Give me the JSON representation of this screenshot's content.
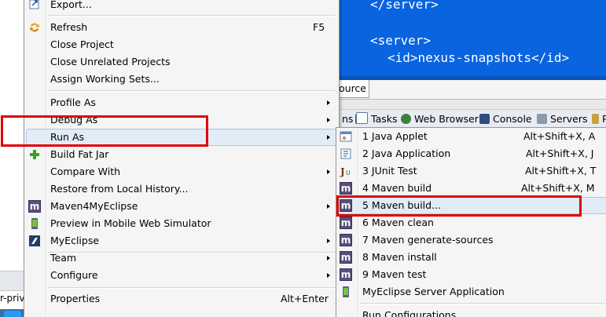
{
  "editor": {
    "lines": [
      "</server>",
      "<server>",
      "<id>nexus-snapshots</id>"
    ]
  },
  "source_tab": {
    "label": "ource"
  },
  "views_bar": {
    "tabs": [
      {
        "label": "ns",
        "icon": "console-icon"
      },
      {
        "label": "Tasks",
        "icon": "tasks-icon"
      },
      {
        "label": "Web Browser",
        "icon": "globe-icon"
      },
      {
        "label": "Console",
        "icon": "console-icon"
      },
      {
        "label": "Servers",
        "icon": "servers-icon"
      },
      {
        "label": "P",
        "icon": "generic-icon"
      }
    ]
  },
  "left_panel": {
    "snippet": "r-priv"
  },
  "context_menu": {
    "items": [
      {
        "label": "Export...",
        "icon": "export-icon"
      },
      {
        "label": "Refresh",
        "shortcut": "F5",
        "icon": "refresh-icon"
      },
      {
        "label": "Close Project"
      },
      {
        "label": "Close Unrelated Projects"
      },
      {
        "label": "Assign Working Sets..."
      },
      {
        "label": "Profile As",
        "submenu": true
      },
      {
        "label": "Debug As",
        "submenu": true
      },
      {
        "label": "Run As",
        "submenu": true,
        "highlighted": true
      },
      {
        "label": "Build Fat Jar",
        "icon": "plus-icon"
      },
      {
        "label": "Compare With",
        "submenu": true
      },
      {
        "label": "Restore from Local History..."
      },
      {
        "label": "Maven4MyEclipse",
        "submenu": true,
        "icon": "maven-icon"
      },
      {
        "label": "Preview in Mobile Web Simulator",
        "icon": "mobile-icon"
      },
      {
        "label": "MyEclipse",
        "submenu": true,
        "icon": "myeclipse-icon"
      },
      {
        "label": "Team",
        "submenu": true
      },
      {
        "label": "Configure",
        "submenu": true
      },
      {
        "label": "Properties",
        "shortcut": "Alt+Enter"
      }
    ]
  },
  "run_as_submenu": {
    "items": [
      {
        "label": "1 Java Applet",
        "shortcut": "Alt+Shift+X, A",
        "icon": "applet-icon"
      },
      {
        "label": "2 Java Application",
        "shortcut": "Alt+Shift+X, J",
        "icon": "java-app-icon"
      },
      {
        "label": "3 JUnit Test",
        "shortcut": "Alt+Shift+X, T",
        "icon": "junit-icon"
      },
      {
        "label": "4 Maven build",
        "shortcut": "Alt+Shift+X, M",
        "icon": "maven-icon"
      },
      {
        "label": "5 Maven build...",
        "icon": "maven-icon",
        "highlighted": true
      },
      {
        "label": "6 Maven clean",
        "icon": "maven-icon"
      },
      {
        "label": "7 Maven generate-sources",
        "icon": "maven-icon"
      },
      {
        "label": "8 Maven install",
        "icon": "maven-icon"
      },
      {
        "label": "9 Maven test",
        "icon": "maven-icon"
      },
      {
        "label": "MyEclipse Server Application",
        "icon": "server-app-icon"
      },
      {
        "label": "Run Configurations..."
      }
    ]
  },
  "colors": {
    "editor_bg": "#0a64e0",
    "annotation": "#e00000",
    "menu_bg": "#f5f5f5",
    "highlight_bg": "#e2ecf7",
    "maven_icon": "#5a4f7c"
  }
}
